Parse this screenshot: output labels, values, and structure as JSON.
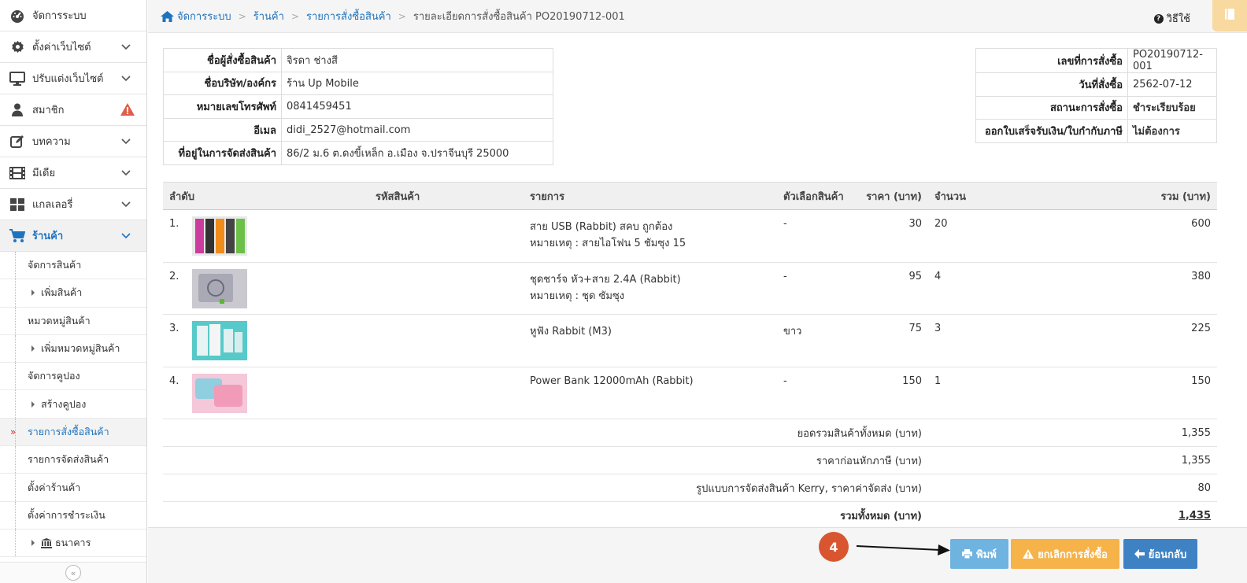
{
  "sidebar": {
    "items": [
      {
        "label": "จัดการระบบ",
        "icon": "dashboard-icon"
      },
      {
        "label": "ตั้งค่าเว็บไซต์",
        "icon": "gear-icon"
      },
      {
        "label": "ปรับแต่งเว็บไซต์",
        "icon": "monitor-icon"
      },
      {
        "label": "สมาชิก",
        "icon": "user-icon"
      },
      {
        "label": "บทความ",
        "icon": "edit-icon"
      },
      {
        "label": "มีเดีย",
        "icon": "film-icon"
      },
      {
        "label": "แกลเลอรี่",
        "icon": "grid-icon"
      },
      {
        "label": "ร้านค้า",
        "icon": "cart-icon"
      }
    ],
    "sub_items": [
      {
        "label": "จัดการสินค้า"
      },
      {
        "label": "เพิ่มสินค้า"
      },
      {
        "label": "หมวดหมู่สินค้า"
      },
      {
        "label": "เพิ่มหมวดหมู่สินค้า"
      },
      {
        "label": "จัดการคูปอง"
      },
      {
        "label": "สร้างคูปอง"
      },
      {
        "label": "รายการสั่งซื้อสินค้า"
      },
      {
        "label": "รายการจัดส่งสินค้า"
      },
      {
        "label": "ตั้งค่าร้านค้า"
      },
      {
        "label": "ตั้งค่าการชำระเงิน"
      },
      {
        "label": "ธนาคาร"
      }
    ],
    "collapse_label": "«"
  },
  "breadcrumb": {
    "items": [
      "จัดการระบบ",
      "ร้านค้า",
      "รายการสั่งซื้อสินค้า"
    ],
    "current": "รายละเอียดการสั่งซื้อสินค้า PO20190712-001"
  },
  "help_label": "วิธีใช้",
  "customer": {
    "rows": [
      {
        "label": "ชื่อผู้สั่งซื้อสินค้า",
        "value": "จิรดา ช่างสี"
      },
      {
        "label": "ชื่อบริษัท/องค์กร",
        "value": "ร้าน Up Mobile"
      },
      {
        "label": "หมายเลขโทรศัพท์",
        "value": "0841459451"
      },
      {
        "label": "อีเมล",
        "value": "didi_2527@hotmail.com"
      },
      {
        "label": "ที่อยู่ในการจัดส่งสินค้า",
        "value": "86/2 ม.6 ต.ดงขี้เหล็ก อ.เมือง จ.ปราจีนบุรี 25000"
      }
    ]
  },
  "order": {
    "rows": [
      {
        "label": "เลขที่การสั่งซื้อ",
        "value": "PO20190712-001"
      },
      {
        "label": "วันที่สั่งซื้อ",
        "value": "2562-07-12"
      },
      {
        "label": "สถานะการสั่งซื้อ",
        "value": "ชำระเรียบร้อย"
      },
      {
        "label": "ออกใบเสร็จรับเงิน/ใบกำกับภาษี",
        "value": "ไม่ต้องการ"
      }
    ]
  },
  "items_table": {
    "headers": [
      "ลำดับ",
      "รหัสสินค้า",
      "รายการ",
      "ตัวเลือกสินค้า",
      "ราคา (บาท)",
      "จำนวน",
      "รวม (บาท)"
    ],
    "rows": [
      {
        "no": "1.",
        "name": "สาย USB (Rabbit) สคบ ถูกต้อง",
        "note": "หมายเหตุ : สายไอโฟน 5 ชัมซุง 15",
        "option": "-",
        "price": "30",
        "qty": "20",
        "total": "600"
      },
      {
        "no": "2.",
        "name": "ชุดชาร์จ หัว+สาย 2.4A (Rabbit)",
        "note": "หมายเหตุ : ชุด ซัมซุง",
        "option": "-",
        "price": "95",
        "qty": "4",
        "total": "380"
      },
      {
        "no": "3.",
        "name": "หูฟัง Rabbit (M3)",
        "note": "",
        "option": "ขาว",
        "price": "75",
        "qty": "3",
        "total": "225"
      },
      {
        "no": "4.",
        "name": "Power Bank 12000mAh (Rabbit)",
        "note": "",
        "option": "-",
        "price": "150",
        "qty": "1",
        "total": "150"
      }
    ],
    "summary": [
      {
        "label": "ยอดรวมสินค้าทั้งหมด (บาท)",
        "value": "1,355"
      },
      {
        "label": "ราคาก่อนหักภาษี (บาท)",
        "value": "1,355"
      },
      {
        "label": "รูปแบบการจัดส่งสินค้า Kerry, ราคาค่าจัดส่ง (บาท)",
        "value": "80"
      },
      {
        "label": "รวมทั้งหมด (บาท)",
        "value": "1,435"
      }
    ]
  },
  "footer": {
    "step": "4",
    "print_label": "พิมพ์",
    "cancel_label": "ยกเลิกการสั่งซื้อ",
    "back_label": "ย้อนกลับ"
  },
  "colors": {
    "link": "#1e73be",
    "print": "#6fb3e0",
    "cancel": "#f5b34a",
    "back": "#3f82c4",
    "status_ok": "#2a9a2a",
    "status_red": "#e00000",
    "step": "#d9552f"
  }
}
